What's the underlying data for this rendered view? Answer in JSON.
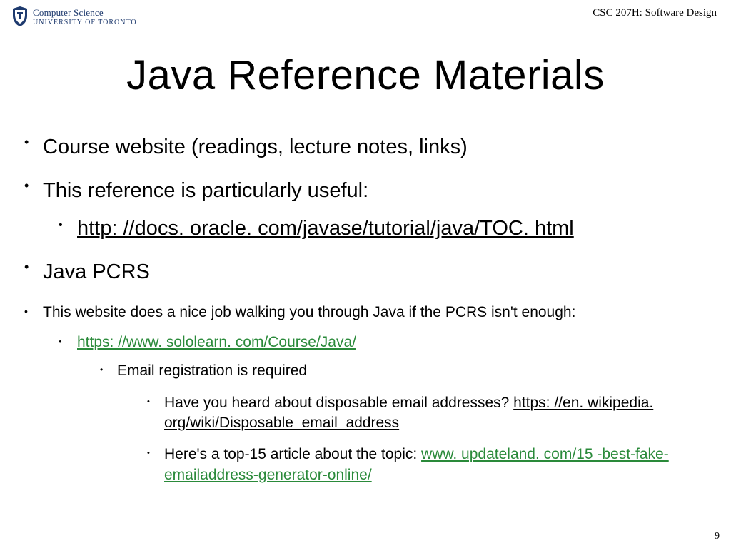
{
  "header": {
    "logo_line1": "Computer Science",
    "logo_line2": "UNIVERSITY OF TORONTO",
    "course_label": "CSC 207H: Software Design"
  },
  "title": "Java Reference Materials",
  "bullets": {
    "b1": "Course website (readings, lecture notes, links)",
    "b2": "This reference is particularly useful:",
    "b2a": "http: //docs. oracle. com/javase/tutorial/java/TOC. html",
    "b3": "Java PCRS",
    "b4": "This website does a nice job walking you through Java if the PCRS isn't enough:",
    "b4a": "https: //www. sololearn. com/Course/Java/",
    "b4a1": "Email registration is required",
    "b4a1a_text": "Have you heard about disposable email addresses? ",
    "b4a1a_link": "https: //en. wikipedia. org/wiki/Disposable_email_address",
    "b4a1b_text": "Here's a top-15 article about the topic: ",
    "b4a1b_link": "www. updateland. com/15 -best-fake-emailaddress-generator-online/"
  },
  "page_number": "9"
}
